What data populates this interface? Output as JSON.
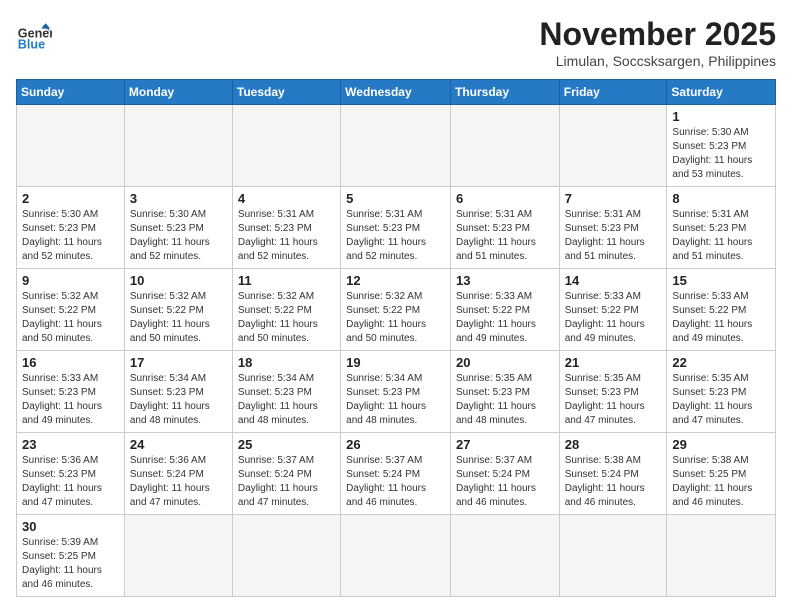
{
  "header": {
    "logo_general": "General",
    "logo_blue": "Blue",
    "month_title": "November 2025",
    "location": "Limulan, Soccsksargen, Philippines"
  },
  "weekdays": [
    "Sunday",
    "Monday",
    "Tuesday",
    "Wednesday",
    "Thursday",
    "Friday",
    "Saturday"
  ],
  "days": {
    "d1": {
      "num": "1",
      "sunrise": "Sunrise: 5:30 AM",
      "sunset": "Sunset: 5:23 PM",
      "daylight": "Daylight: 11 hours and 53 minutes."
    },
    "d2": {
      "num": "2",
      "sunrise": "Sunrise: 5:30 AM",
      "sunset": "Sunset: 5:23 PM",
      "daylight": "Daylight: 11 hours and 52 minutes."
    },
    "d3": {
      "num": "3",
      "sunrise": "Sunrise: 5:30 AM",
      "sunset": "Sunset: 5:23 PM",
      "daylight": "Daylight: 11 hours and 52 minutes."
    },
    "d4": {
      "num": "4",
      "sunrise": "Sunrise: 5:31 AM",
      "sunset": "Sunset: 5:23 PM",
      "daylight": "Daylight: 11 hours and 52 minutes."
    },
    "d5": {
      "num": "5",
      "sunrise": "Sunrise: 5:31 AM",
      "sunset": "Sunset: 5:23 PM",
      "daylight": "Daylight: 11 hours and 52 minutes."
    },
    "d6": {
      "num": "6",
      "sunrise": "Sunrise: 5:31 AM",
      "sunset": "Sunset: 5:23 PM",
      "daylight": "Daylight: 11 hours and 51 minutes."
    },
    "d7": {
      "num": "7",
      "sunrise": "Sunrise: 5:31 AM",
      "sunset": "Sunset: 5:23 PM",
      "daylight": "Daylight: 11 hours and 51 minutes."
    },
    "d8": {
      "num": "8",
      "sunrise": "Sunrise: 5:31 AM",
      "sunset": "Sunset: 5:23 PM",
      "daylight": "Daylight: 11 hours and 51 minutes."
    },
    "d9": {
      "num": "9",
      "sunrise": "Sunrise: 5:32 AM",
      "sunset": "Sunset: 5:22 PM",
      "daylight": "Daylight: 11 hours and 50 minutes."
    },
    "d10": {
      "num": "10",
      "sunrise": "Sunrise: 5:32 AM",
      "sunset": "Sunset: 5:22 PM",
      "daylight": "Daylight: 11 hours and 50 minutes."
    },
    "d11": {
      "num": "11",
      "sunrise": "Sunrise: 5:32 AM",
      "sunset": "Sunset: 5:22 PM",
      "daylight": "Daylight: 11 hours and 50 minutes."
    },
    "d12": {
      "num": "12",
      "sunrise": "Sunrise: 5:32 AM",
      "sunset": "Sunset: 5:22 PM",
      "daylight": "Daylight: 11 hours and 50 minutes."
    },
    "d13": {
      "num": "13",
      "sunrise": "Sunrise: 5:33 AM",
      "sunset": "Sunset: 5:22 PM",
      "daylight": "Daylight: 11 hours and 49 minutes."
    },
    "d14": {
      "num": "14",
      "sunrise": "Sunrise: 5:33 AM",
      "sunset": "Sunset: 5:22 PM",
      "daylight": "Daylight: 11 hours and 49 minutes."
    },
    "d15": {
      "num": "15",
      "sunrise": "Sunrise: 5:33 AM",
      "sunset": "Sunset: 5:22 PM",
      "daylight": "Daylight: 11 hours and 49 minutes."
    },
    "d16": {
      "num": "16",
      "sunrise": "Sunrise: 5:33 AM",
      "sunset": "Sunset: 5:23 PM",
      "daylight": "Daylight: 11 hours and 49 minutes."
    },
    "d17": {
      "num": "17",
      "sunrise": "Sunrise: 5:34 AM",
      "sunset": "Sunset: 5:23 PM",
      "daylight": "Daylight: 11 hours and 48 minutes."
    },
    "d18": {
      "num": "18",
      "sunrise": "Sunrise: 5:34 AM",
      "sunset": "Sunset: 5:23 PM",
      "daylight": "Daylight: 11 hours and 48 minutes."
    },
    "d19": {
      "num": "19",
      "sunrise": "Sunrise: 5:34 AM",
      "sunset": "Sunset: 5:23 PM",
      "daylight": "Daylight: 11 hours and 48 minutes."
    },
    "d20": {
      "num": "20",
      "sunrise": "Sunrise: 5:35 AM",
      "sunset": "Sunset: 5:23 PM",
      "daylight": "Daylight: 11 hours and 48 minutes."
    },
    "d21": {
      "num": "21",
      "sunrise": "Sunrise: 5:35 AM",
      "sunset": "Sunset: 5:23 PM",
      "daylight": "Daylight: 11 hours and 47 minutes."
    },
    "d22": {
      "num": "22",
      "sunrise": "Sunrise: 5:35 AM",
      "sunset": "Sunset: 5:23 PM",
      "daylight": "Daylight: 11 hours and 47 minutes."
    },
    "d23": {
      "num": "23",
      "sunrise": "Sunrise: 5:36 AM",
      "sunset": "Sunset: 5:23 PM",
      "daylight": "Daylight: 11 hours and 47 minutes."
    },
    "d24": {
      "num": "24",
      "sunrise": "Sunrise: 5:36 AM",
      "sunset": "Sunset: 5:24 PM",
      "daylight": "Daylight: 11 hours and 47 minutes."
    },
    "d25": {
      "num": "25",
      "sunrise": "Sunrise: 5:37 AM",
      "sunset": "Sunset: 5:24 PM",
      "daylight": "Daylight: 11 hours and 47 minutes."
    },
    "d26": {
      "num": "26",
      "sunrise": "Sunrise: 5:37 AM",
      "sunset": "Sunset: 5:24 PM",
      "daylight": "Daylight: 11 hours and 46 minutes."
    },
    "d27": {
      "num": "27",
      "sunrise": "Sunrise: 5:37 AM",
      "sunset": "Sunset: 5:24 PM",
      "daylight": "Daylight: 11 hours and 46 minutes."
    },
    "d28": {
      "num": "28",
      "sunrise": "Sunrise: 5:38 AM",
      "sunset": "Sunset: 5:24 PM",
      "daylight": "Daylight: 11 hours and 46 minutes."
    },
    "d29": {
      "num": "29",
      "sunrise": "Sunrise: 5:38 AM",
      "sunset": "Sunset: 5:25 PM",
      "daylight": "Daylight: 11 hours and 46 minutes."
    },
    "d30": {
      "num": "30",
      "sunrise": "Sunrise: 5:39 AM",
      "sunset": "Sunset: 5:25 PM",
      "daylight": "Daylight: 11 hours and 46 minutes."
    }
  }
}
